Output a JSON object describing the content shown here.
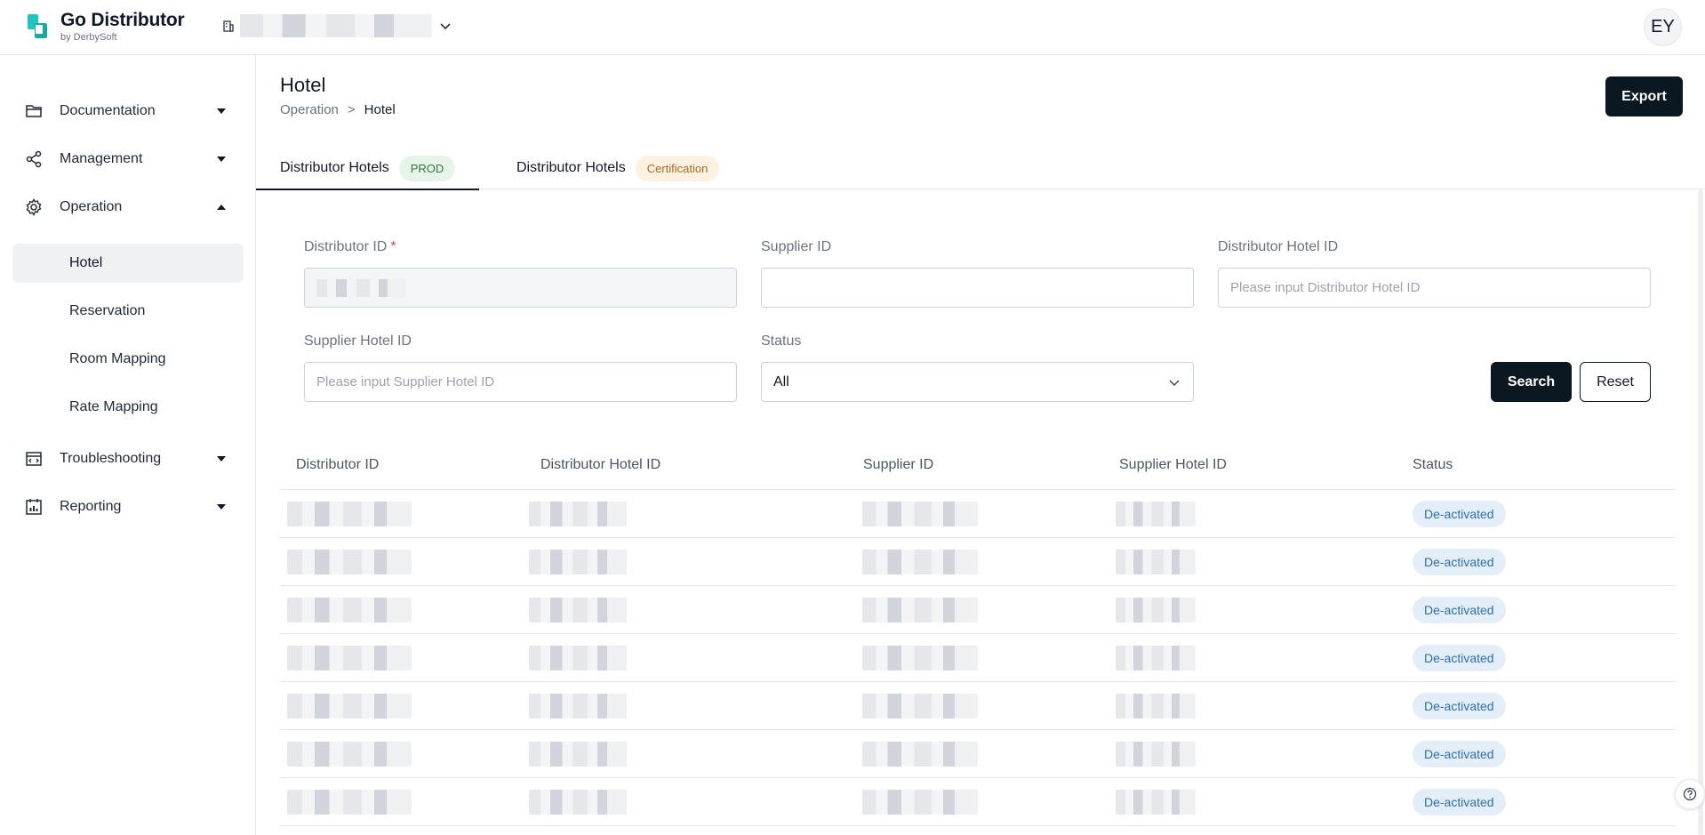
{
  "app": {
    "brand_title": "Go Distributor",
    "brand_sub": "by DerbySoft",
    "avatar_initials": "EY",
    "accent_color": "#0b1721",
    "logo_color": "#1fc6c0"
  },
  "sidebar": {
    "items": [
      {
        "label": "Documentation",
        "icon": "folder-icon",
        "expanded": false
      },
      {
        "label": "Management",
        "icon": "share-nodes-icon",
        "expanded": false
      },
      {
        "label": "Operation",
        "icon": "gear-icon",
        "expanded": true
      },
      {
        "label": "Troubleshooting",
        "icon": "code-window-icon",
        "expanded": false
      },
      {
        "label": "Reporting",
        "icon": "calendar-chart-icon",
        "expanded": false
      }
    ],
    "operation_subitems": [
      {
        "label": "Hotel",
        "active": true
      },
      {
        "label": "Reservation",
        "active": false
      },
      {
        "label": "Room Mapping",
        "active": false
      },
      {
        "label": "Rate Mapping",
        "active": false
      }
    ]
  },
  "header": {
    "title": "Hotel",
    "breadcrumb": [
      "Operation",
      ">",
      "Hotel"
    ],
    "export_label": "Export"
  },
  "tabs": [
    {
      "label": "Distributor Hotels",
      "badge": "PROD",
      "active": true
    },
    {
      "label": "Distributor Hotels",
      "badge": "Certification",
      "active": false
    }
  ],
  "filters": {
    "distributor_id": {
      "label": "Distributor ID",
      "required_mark": "*",
      "value": "",
      "disabled": true
    },
    "supplier_id": {
      "label": "Supplier ID",
      "value": "",
      "placeholder": ""
    },
    "distributor_hotel_id": {
      "label": "Distributor Hotel ID",
      "placeholder": "Please input Distributor Hotel ID"
    },
    "supplier_hotel_id": {
      "label": "Supplier Hotel ID",
      "placeholder": "Please input Supplier Hotel ID"
    },
    "status": {
      "label": "Status",
      "value": "All"
    },
    "search_label": "Search",
    "reset_label": "Reset"
  },
  "table": {
    "columns": [
      "Distributor ID",
      "Distributor Hotel ID",
      "Supplier ID",
      "Supplier Hotel ID",
      "Status"
    ],
    "rows": [
      {
        "status": "De-activated"
      },
      {
        "status": "De-activated"
      },
      {
        "status": "De-activated"
      },
      {
        "status": "De-activated"
      },
      {
        "status": "De-activated"
      },
      {
        "status": "De-activated"
      },
      {
        "status": "De-activated"
      }
    ]
  }
}
